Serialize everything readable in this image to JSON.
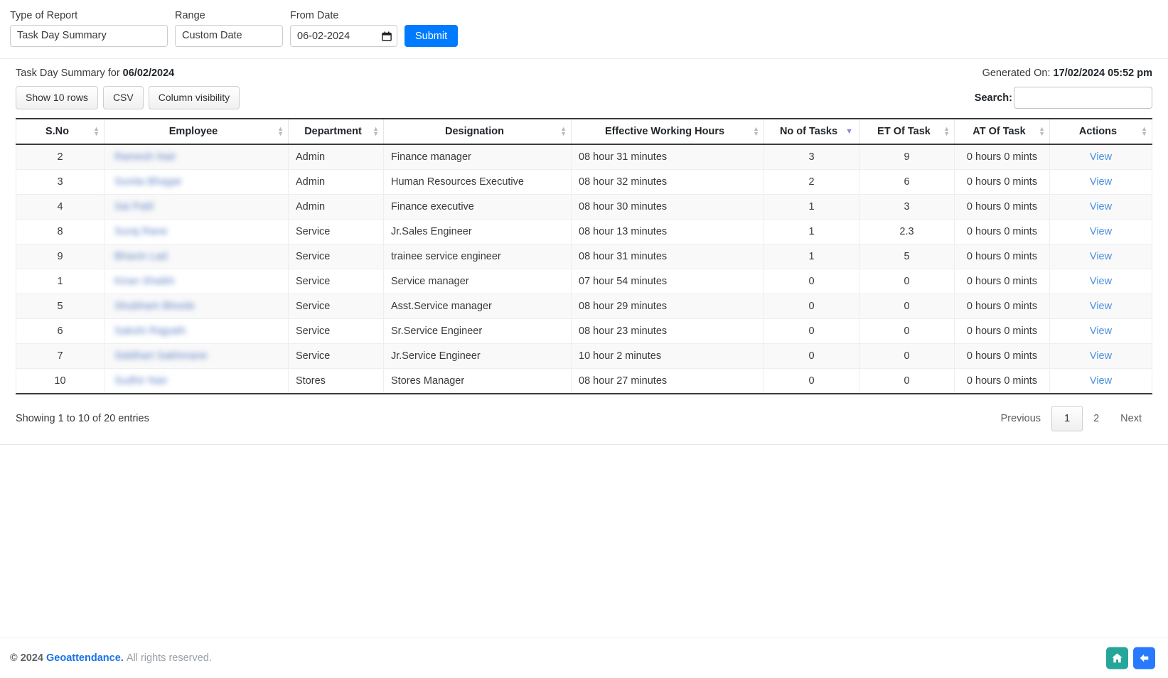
{
  "filters": {
    "report_type": {
      "label": "Type of Report",
      "value": "Task Day Summary"
    },
    "range": {
      "label": "Range",
      "value": "Custom Date"
    },
    "from_date": {
      "label": "From Date",
      "value": "06-02-2024"
    },
    "submit_label": "Submit"
  },
  "report": {
    "title_prefix": "Task Day Summary for ",
    "title_date": "06/02/2024",
    "generated_prefix": "Generated On: ",
    "generated_value": "17/02/2024 05:52 pm"
  },
  "toolbar": {
    "show_rows_label": "Show 10 rows",
    "csv_label": "CSV",
    "column_visibility_label": "Column visibility",
    "search_label": "Search:",
    "search_value": "",
    "search_placeholder": ""
  },
  "table": {
    "columns": [
      {
        "label": "S.No",
        "sort": "none"
      },
      {
        "label": "Employee",
        "sort": "none"
      },
      {
        "label": "Department",
        "sort": "none"
      },
      {
        "label": "Designation",
        "sort": "none"
      },
      {
        "label": "Effective Working Hours",
        "sort": "none"
      },
      {
        "label": "No of Tasks",
        "sort": "desc"
      },
      {
        "label": "ET Of Task",
        "sort": "none"
      },
      {
        "label": "AT Of Task",
        "sort": "none"
      },
      {
        "label": "Actions",
        "sort": "none"
      }
    ],
    "rows": [
      {
        "sno": "2",
        "employee": "Ramesh Nair",
        "department": "Admin",
        "designation": "Finance manager",
        "hours": "08 hour 31 minutes",
        "tasks": "3",
        "et": "9",
        "at": "0 hours 0 mints",
        "action": "View"
      },
      {
        "sno": "3",
        "employee": "Sunita Bhagat",
        "department": "Admin",
        "designation": "Human Resources Executive",
        "hours": "08 hour 32 minutes",
        "tasks": "2",
        "et": "6",
        "at": "0 hours 0 mints",
        "action": "View"
      },
      {
        "sno": "4",
        "employee": "Sai Patil",
        "department": "Admin",
        "designation": "Finance executive",
        "hours": "08 hour 30 minutes",
        "tasks": "1",
        "et": "3",
        "at": "0 hours 0 mints",
        "action": "View"
      },
      {
        "sno": "8",
        "employee": "Suraj Rane",
        "department": "Service",
        "designation": "Jr.Sales Engineer",
        "hours": "08 hour 13 minutes",
        "tasks": "1",
        "et": "2.3",
        "at": "0 hours 0 mints",
        "action": "View"
      },
      {
        "sno": "9",
        "employee": "Bhavin Lad",
        "department": "Service",
        "designation": "trainee service engineer",
        "hours": "08 hour 31 minutes",
        "tasks": "1",
        "et": "5",
        "at": "0 hours 0 mints",
        "action": "View"
      },
      {
        "sno": "1",
        "employee": "Kiran Shaikh",
        "department": "Service",
        "designation": "Service manager",
        "hours": "07 hour 54 minutes",
        "tasks": "0",
        "et": "0",
        "at": "0 hours 0 mints",
        "action": "View"
      },
      {
        "sno": "5",
        "employee": "Shubham Bhosle",
        "department": "Service",
        "designation": "Asst.Service manager",
        "hours": "08 hour 29 minutes",
        "tasks": "0",
        "et": "0",
        "at": "0 hours 0 mints",
        "action": "View"
      },
      {
        "sno": "6",
        "employee": "Sakshi Rajpath",
        "department": "Service",
        "designation": "Sr.Service Engineer",
        "hours": "08 hour 23 minutes",
        "tasks": "0",
        "et": "0",
        "at": "0 hours 0 mints",
        "action": "View"
      },
      {
        "sno": "7",
        "employee": "Siddhart Sakhmane",
        "department": "Service",
        "designation": "Jr.Service Engineer",
        "hours": "10 hour 2 minutes",
        "tasks": "0",
        "et": "0",
        "at": "0 hours 0 mints",
        "action": "View"
      },
      {
        "sno": "10",
        "employee": "Sudhir Nair",
        "department": "Stores",
        "designation": "Stores Manager",
        "hours": "08 hour 27 minutes",
        "tasks": "0",
        "et": "0",
        "at": "0 hours 0 mints",
        "action": "View"
      }
    ]
  },
  "pagination": {
    "info": "Showing 1 to 10 of 20 entries",
    "previous_label": "Previous",
    "next_label": "Next",
    "pages": [
      "1",
      "2"
    ],
    "current_page": "1"
  },
  "footer": {
    "copyright_year": "© 2024",
    "brand": "Geoattendance.",
    "rights": "All rights reserved.",
    "home_icon": "home-icon",
    "back_icon": "arrow-left-icon"
  },
  "colors": {
    "primary_blue": "#007bff",
    "link_blue": "#4a90e2",
    "brand_blue": "#1a73e8",
    "fab_teal": "#26a69a",
    "fab_blue": "#2979ff",
    "sort_active": "#8b8bd6"
  }
}
